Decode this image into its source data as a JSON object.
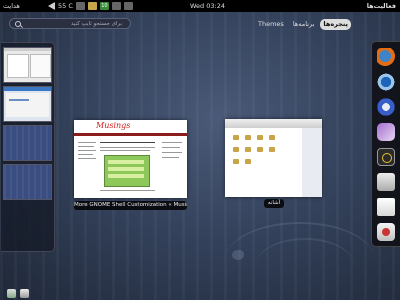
{
  "topbar": {
    "activities_label": "فعالیت‌ها",
    "clock": "Wed 03:24",
    "user_label": "هدایت",
    "temperature": "55 C",
    "tray_badge": "10"
  },
  "search": {
    "placeholder": "برای جستجو تایپ کنید"
  },
  "view_tabs": [
    {
      "label": "Themes",
      "active": false
    },
    {
      "label": "برنامه‌ها",
      "active": false
    },
    {
      "label": "پنجره‌ها",
      "active": true
    }
  ],
  "windows": [
    {
      "caption": "More GNOME Shell Customization « Musings of…",
      "content_title": "Musings"
    },
    {
      "caption": "آشانه"
    }
  ],
  "dash_icons": [
    "firefox-icon",
    "thunderbird-icon",
    "empathy-icon",
    "chat-icon",
    "rhythmbox-icon",
    "drive-icon",
    "writer-icon",
    "software-center-icon"
  ],
  "colors": {
    "topbar": "#000000",
    "active_tab": "#dddddd",
    "brand_red": "#d02020"
  }
}
